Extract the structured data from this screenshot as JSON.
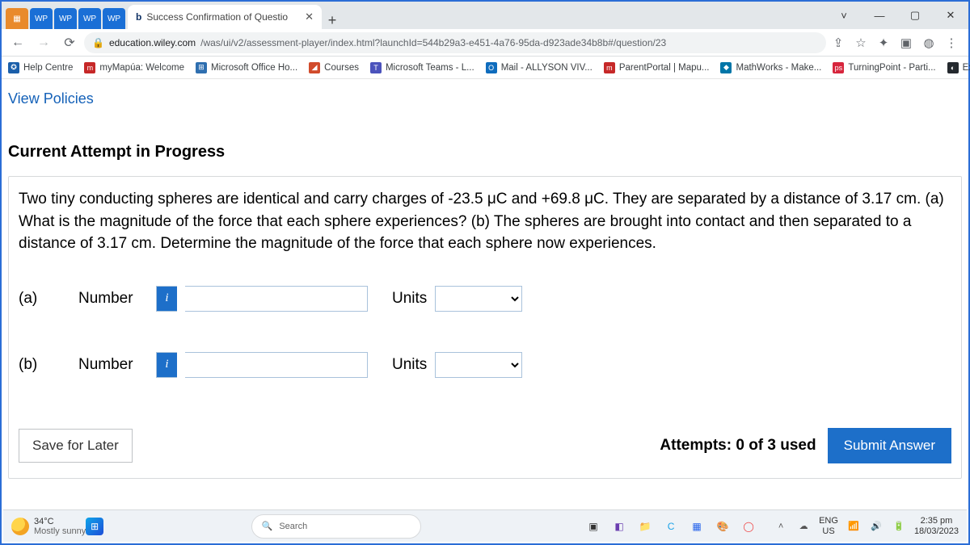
{
  "window": {
    "title": "Success Confirmation of Questio"
  },
  "nav": {
    "url_host": "education.wiley.com",
    "url_path": "/was/ui/v2/assessment-player/index.html?launchId=544b29a3-e451-4a76-95da-d923ade34b8b#/question/23"
  },
  "bookmarks": [
    {
      "label": "Help Centre"
    },
    {
      "label": "myMapúa: Welcome"
    },
    {
      "label": "Microsoft Office Ho..."
    },
    {
      "label": "Courses"
    },
    {
      "label": "Microsoft Teams - L..."
    },
    {
      "label": "Mail - ALLYSON VIV..."
    },
    {
      "label": "ParentPortal | Mapu..."
    },
    {
      "label": "MathWorks - Make..."
    },
    {
      "label": "TurningPoint - Parti..."
    },
    {
      "label": "Explore GitHub"
    }
  ],
  "page": {
    "policies": "View Policies",
    "heading": "Current Attempt in Progress",
    "question": "Two tiny conducting spheres are identical and carry charges of -23.5 μC and +69.8 μC. They are separated by a distance of 3.17 cm. (a) What is the magnitude of the force that each sphere experiences? (b) The spheres are brought into contact and then separated to a distance of 3.17 cm. Determine the magnitude of the force that each sphere now experiences.",
    "rows": [
      {
        "part": "(a)",
        "label": "Number",
        "units": "Units"
      },
      {
        "part": "(b)",
        "label": "Number",
        "units": "Units"
      }
    ],
    "save": "Save for Later",
    "attempts": "Attempts: 0 of 3 used",
    "submit": "Submit Answer"
  },
  "taskbar": {
    "temp": "34°C",
    "cond": "Mostly sunny",
    "search": "Search",
    "lang1": "ENG",
    "lang2": "US",
    "time": "2:35 pm",
    "date": "18/03/2023"
  }
}
